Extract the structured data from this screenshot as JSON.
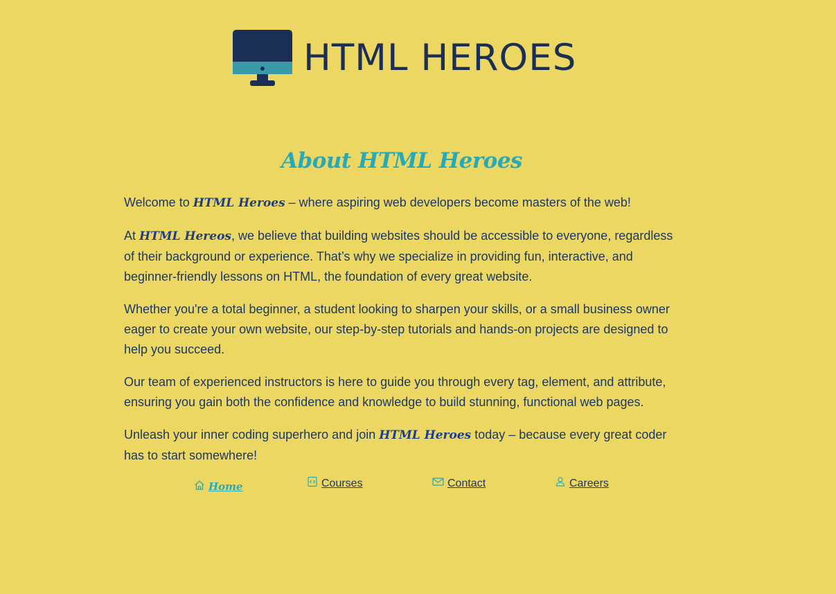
{
  "header": {
    "logo_text": "HTML HEROES",
    "icon": "monitor-icon"
  },
  "about": {
    "title": "About HTML Heroes",
    "p1": {
      "pre": "Welcome to ",
      "brand": "HTML Heroes",
      "post": " – where aspiring web developers become masters of the web!"
    },
    "p2": {
      "pre": "At ",
      "brand": "HTML Hereos",
      "post": ", we believe that building websites should be accessible to everyone, regardless of their background or experience. That’s why we specialize in providing fun, interactive, and beginner-friendly lessons on HTML, the foundation of every great website."
    },
    "p3": "Whether you're a total beginner, a student looking to sharpen your skills, or a small business owner eager to create your own website, our step-by-step tutorials and hands-on projects are designed to help you succeed.",
    "p4": "Our team of experienced instructors is here to guide you through every tag, element, and attribute, ensuring you gain both the confidence and knowledge to build stunning, functional web pages.",
    "p5": {
      "pre": "Unleash your inner coding superhero and join ",
      "brand": "HTML Heroes",
      "post": " today – because every great coder has to start somewhere!"
    }
  },
  "nav": {
    "home": {
      "label": "Home",
      "icon": "home-icon"
    },
    "courses": {
      "label": "Courses",
      "icon": "code-file-icon"
    },
    "contact": {
      "label": "Contact",
      "icon": "envelope-icon"
    },
    "careers": {
      "label": "Careers",
      "icon": "user-icon"
    }
  },
  "colors": {
    "background": "#ecd763",
    "text": "#1d3864",
    "accent": "#27aab8",
    "brand": "#1d3f87"
  }
}
